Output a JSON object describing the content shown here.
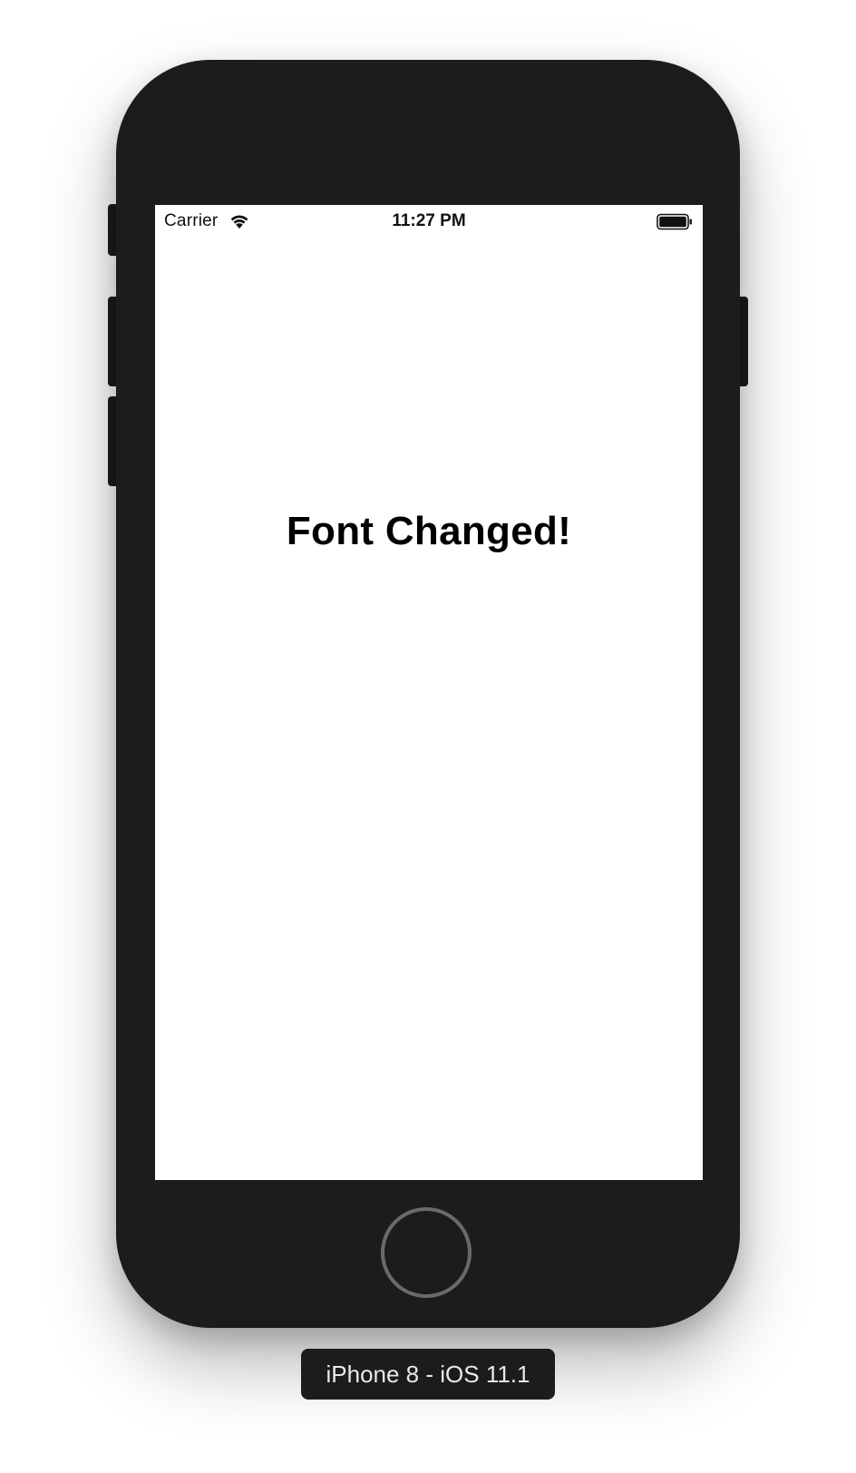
{
  "status_bar": {
    "carrier": "Carrier",
    "time": "11:27 PM",
    "wifi_icon": "wifi-icon",
    "battery_icon": "battery-full-icon",
    "battery_level": 1.0
  },
  "content": {
    "headline": "Font Changed!"
  },
  "device": {
    "label": "iPhone 8 - iOS 11.1",
    "body_color": "#1c1c1c",
    "screen_color": "#ffffff"
  }
}
